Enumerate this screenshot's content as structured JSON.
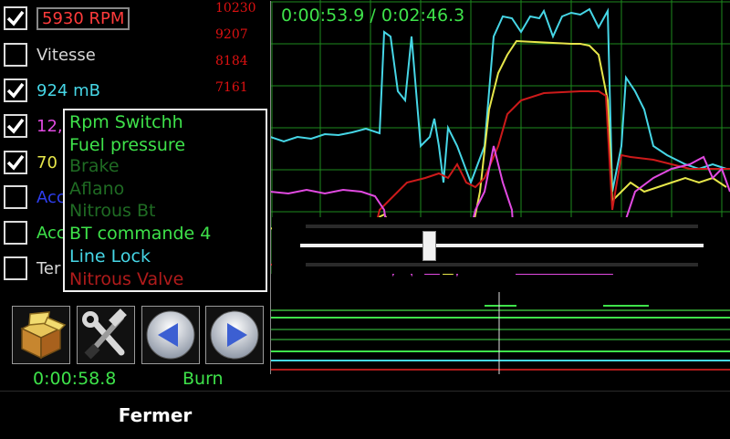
{
  "channels": [
    {
      "label": "5930 RPM",
      "checked": true,
      "color": "#ff3b3b"
    },
    {
      "label": "Vitesse",
      "checked": false,
      "color": "#d8d8d8"
    },
    {
      "label": "924 mB",
      "checked": true,
      "color": "#46d6e6"
    },
    {
      "label": "12,",
      "checked": true,
      "color": "#e14ae1"
    },
    {
      "label": "70",
      "checked": true,
      "color": "#e6e64a"
    },
    {
      "label": "Acc",
      "checked": false,
      "color": "#2e3ef0"
    },
    {
      "label": "Acc",
      "checked": false,
      "color": "#3ee24a"
    },
    {
      "label": "Ter",
      "checked": false,
      "color": "#d8d8d8"
    }
  ],
  "scale": [
    "10230",
    "9207",
    "8184",
    "7161"
  ],
  "graph": {
    "time_readout": "0:00:53.9 / 0:02:46.3"
  },
  "legend": [
    {
      "label": "Rpm Switchh",
      "color": "#3ee24a"
    },
    {
      "label": "Fuel pressure",
      "color": "#3ee24a"
    },
    {
      "label": "Brake",
      "color": "#1f6b23"
    },
    {
      "label": "Aflano",
      "color": "#1f6b23"
    },
    {
      "label": "Nitrous Bt",
      "color": "#1f6b23"
    },
    {
      "label": "BT commande 4",
      "color": "#3ee24a"
    },
    {
      "label": "Line Lock",
      "color": "#46d6e6"
    },
    {
      "label": "Nitrous Valve",
      "color": "#b01b1b"
    }
  ],
  "slider": {
    "position_fraction": 0.32
  },
  "toolbar": {
    "package_icon": "package-icon",
    "tools_icon": "tools-icon",
    "prev_icon": "previous-icon",
    "next_icon": "next-icon",
    "elapsed": "0:00:58.8",
    "mode": "Burn"
  },
  "footer": {
    "close_label": "Fermer"
  }
}
